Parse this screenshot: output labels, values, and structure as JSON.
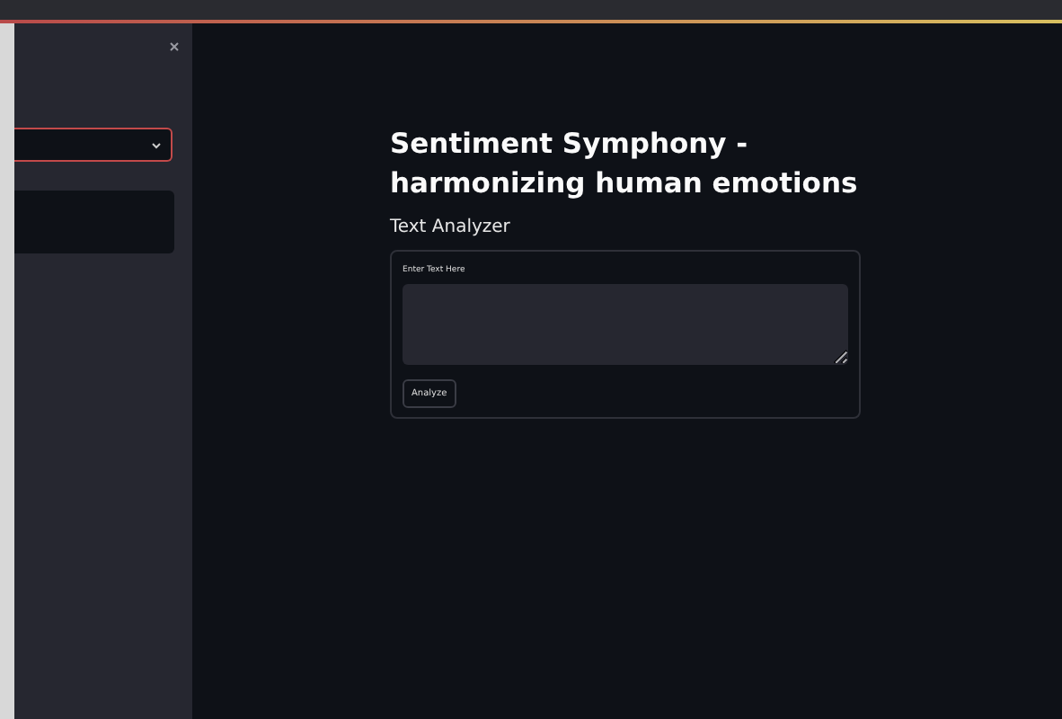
{
  "sidebar": {
    "expanded": true
  },
  "main": {
    "title": "Sentiment Symphony -harmonizing human emotions",
    "subheader": "Text Analyzer",
    "form": {
      "field_label": "Enter Text Here",
      "button": "Analyze"
    }
  }
}
